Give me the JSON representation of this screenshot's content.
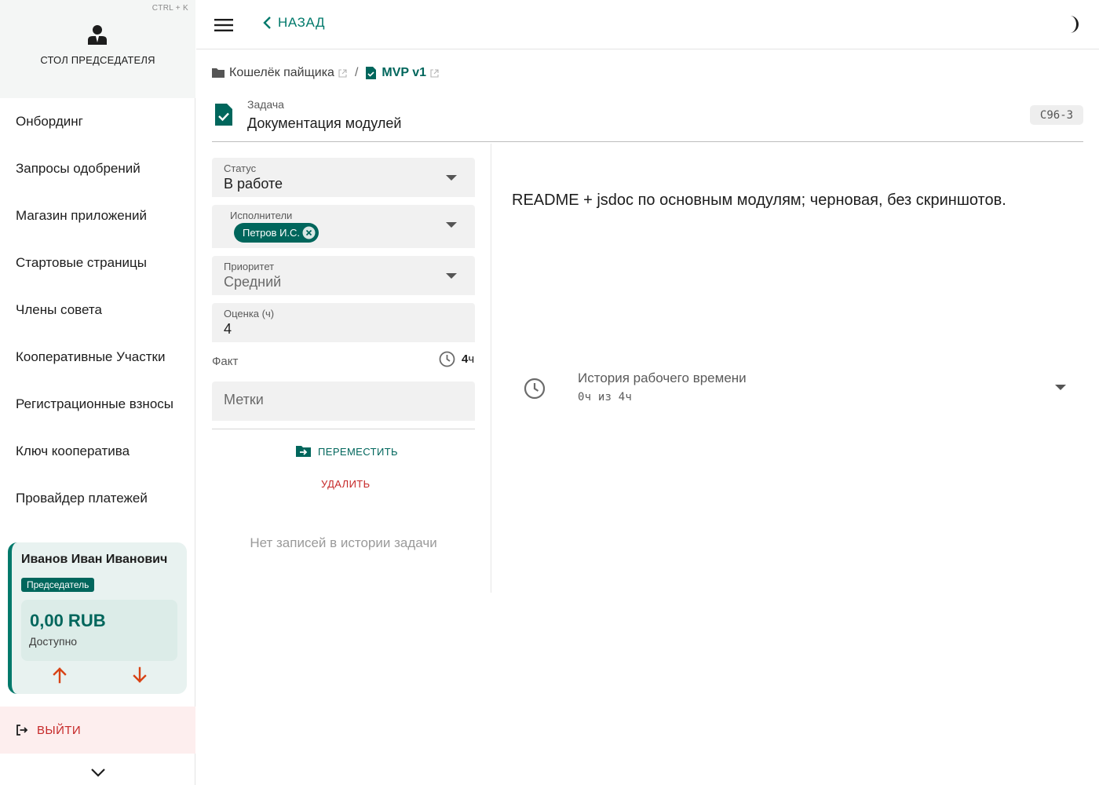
{
  "sidebar": {
    "shortcut": "CTRL + K",
    "title": "СТОЛ ПРЕДСЕДАТЕЛЯ",
    "logo_icon": "person-suit-icon",
    "items": [
      {
        "label": "Онбординг"
      },
      {
        "label": "Запросы одобрений"
      },
      {
        "label": "Магазин приложений"
      },
      {
        "label": "Стартовые страницы"
      },
      {
        "label": "Члены совета"
      },
      {
        "label": "Кооперативные Участки"
      },
      {
        "label": "Регистрационные взносы"
      },
      {
        "label": "Ключ кооператива"
      },
      {
        "label": "Провайдер платежей"
      }
    ],
    "user": {
      "name": "Иванов Иван Иванович",
      "role": "Председатель",
      "balance": "0,00 RUB",
      "balance_label": "Доступно"
    },
    "logout_label": "ВЫЙТИ"
  },
  "topbar": {
    "back_label": "НАЗАД"
  },
  "breadcrumb": {
    "project": "Кошелёк пайщика",
    "separator": "/",
    "current": "MVP v1"
  },
  "task": {
    "label": "Задача",
    "title": "Документация модулей",
    "code": "C96-3"
  },
  "form": {
    "status": {
      "label": "Статус",
      "value": "В работе"
    },
    "assignees": {
      "label": "Исполнители",
      "chips": [
        "Петров И.С."
      ]
    },
    "priority": {
      "label": "Приоритет",
      "value": "Средний"
    },
    "estimate": {
      "label": "Оценка (ч)",
      "value": "4"
    },
    "fact": {
      "label": "Факт",
      "value": "4",
      "unit": "ч"
    },
    "tags": {
      "label": "Метки"
    },
    "move_label": "ПЕРЕМЕСТИТЬ",
    "delete_label": "УДАЛИТЬ",
    "empty_history": "Нет записей в истории задачи"
  },
  "details": {
    "description": "README + jsdoc по основным модулям; черновая, без скриншотов.",
    "work_history": {
      "title": "История рабочего времени",
      "summary": "0ч из 4ч"
    }
  },
  "colors": {
    "accent": "#00665c",
    "danger": "#c62828"
  }
}
